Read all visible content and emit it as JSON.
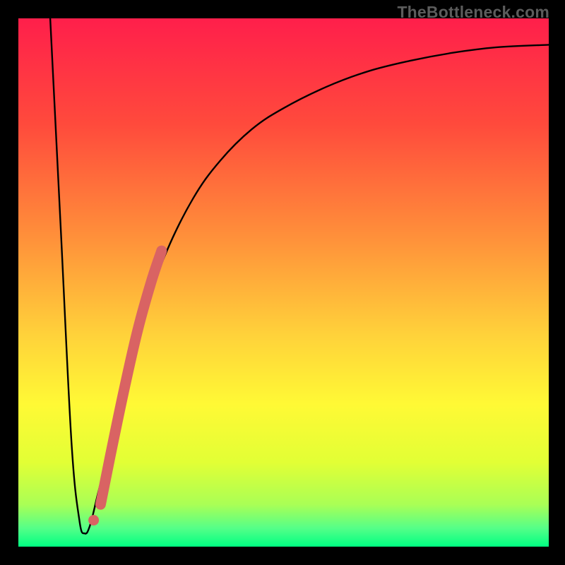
{
  "watermark": "TheBottleneck.com",
  "colors": {
    "black_frame": "#000000",
    "curve_stroke": "#000000",
    "accent_red": "#d96363",
    "gradient_stops": [
      {
        "offset": 0.0,
        "color": "#ff1f4b"
      },
      {
        "offset": 0.2,
        "color": "#ff4a3c"
      },
      {
        "offset": 0.42,
        "color": "#ff923a"
      },
      {
        "offset": 0.6,
        "color": "#ffd23a"
      },
      {
        "offset": 0.73,
        "color": "#fff935"
      },
      {
        "offset": 0.84,
        "color": "#e2ff35"
      },
      {
        "offset": 0.92,
        "color": "#aaff55"
      },
      {
        "offset": 0.965,
        "color": "#55ff88"
      },
      {
        "offset": 1.0,
        "color": "#00ff82"
      }
    ]
  },
  "chart_data": {
    "type": "line",
    "title": "",
    "xlabel": "",
    "ylabel": "",
    "xlim": [
      0,
      100
    ],
    "ylim": [
      0,
      100
    ],
    "grid": false,
    "legend": false,
    "annotations": [
      "TheBottleneck.com"
    ],
    "series": [
      {
        "name": "bottleneck-curve",
        "x": [
          6,
          8,
          10,
          11.5,
          12.5,
          13.5,
          15,
          17,
          20,
          24,
          28,
          33,
          38,
          44,
          50,
          58,
          66,
          74,
          82,
          90,
          100
        ],
        "y": [
          100,
          60,
          20,
          5,
          2.5,
          4,
          10,
          18,
          30,
          45,
          56,
          66,
          73,
          79,
          83,
          87,
          90,
          92,
          93.5,
          94.5,
          95
        ],
        "note": "x is position along the horizontal axis (0–100), y is height above the bottom (0–100). Values estimated from pixel positions."
      }
    ],
    "accent_segment": {
      "description": "thick salmon segment overlaying the right wall of the dip",
      "x": [
        15.5,
        17.5,
        20.0,
        22.5,
        25.0,
        27.0
      ],
      "y": [
        8.0,
        18.0,
        30.0,
        41.0,
        50.0,
        56.0
      ]
    },
    "accent_dot": {
      "x": 14.2,
      "y": 5.0
    }
  }
}
